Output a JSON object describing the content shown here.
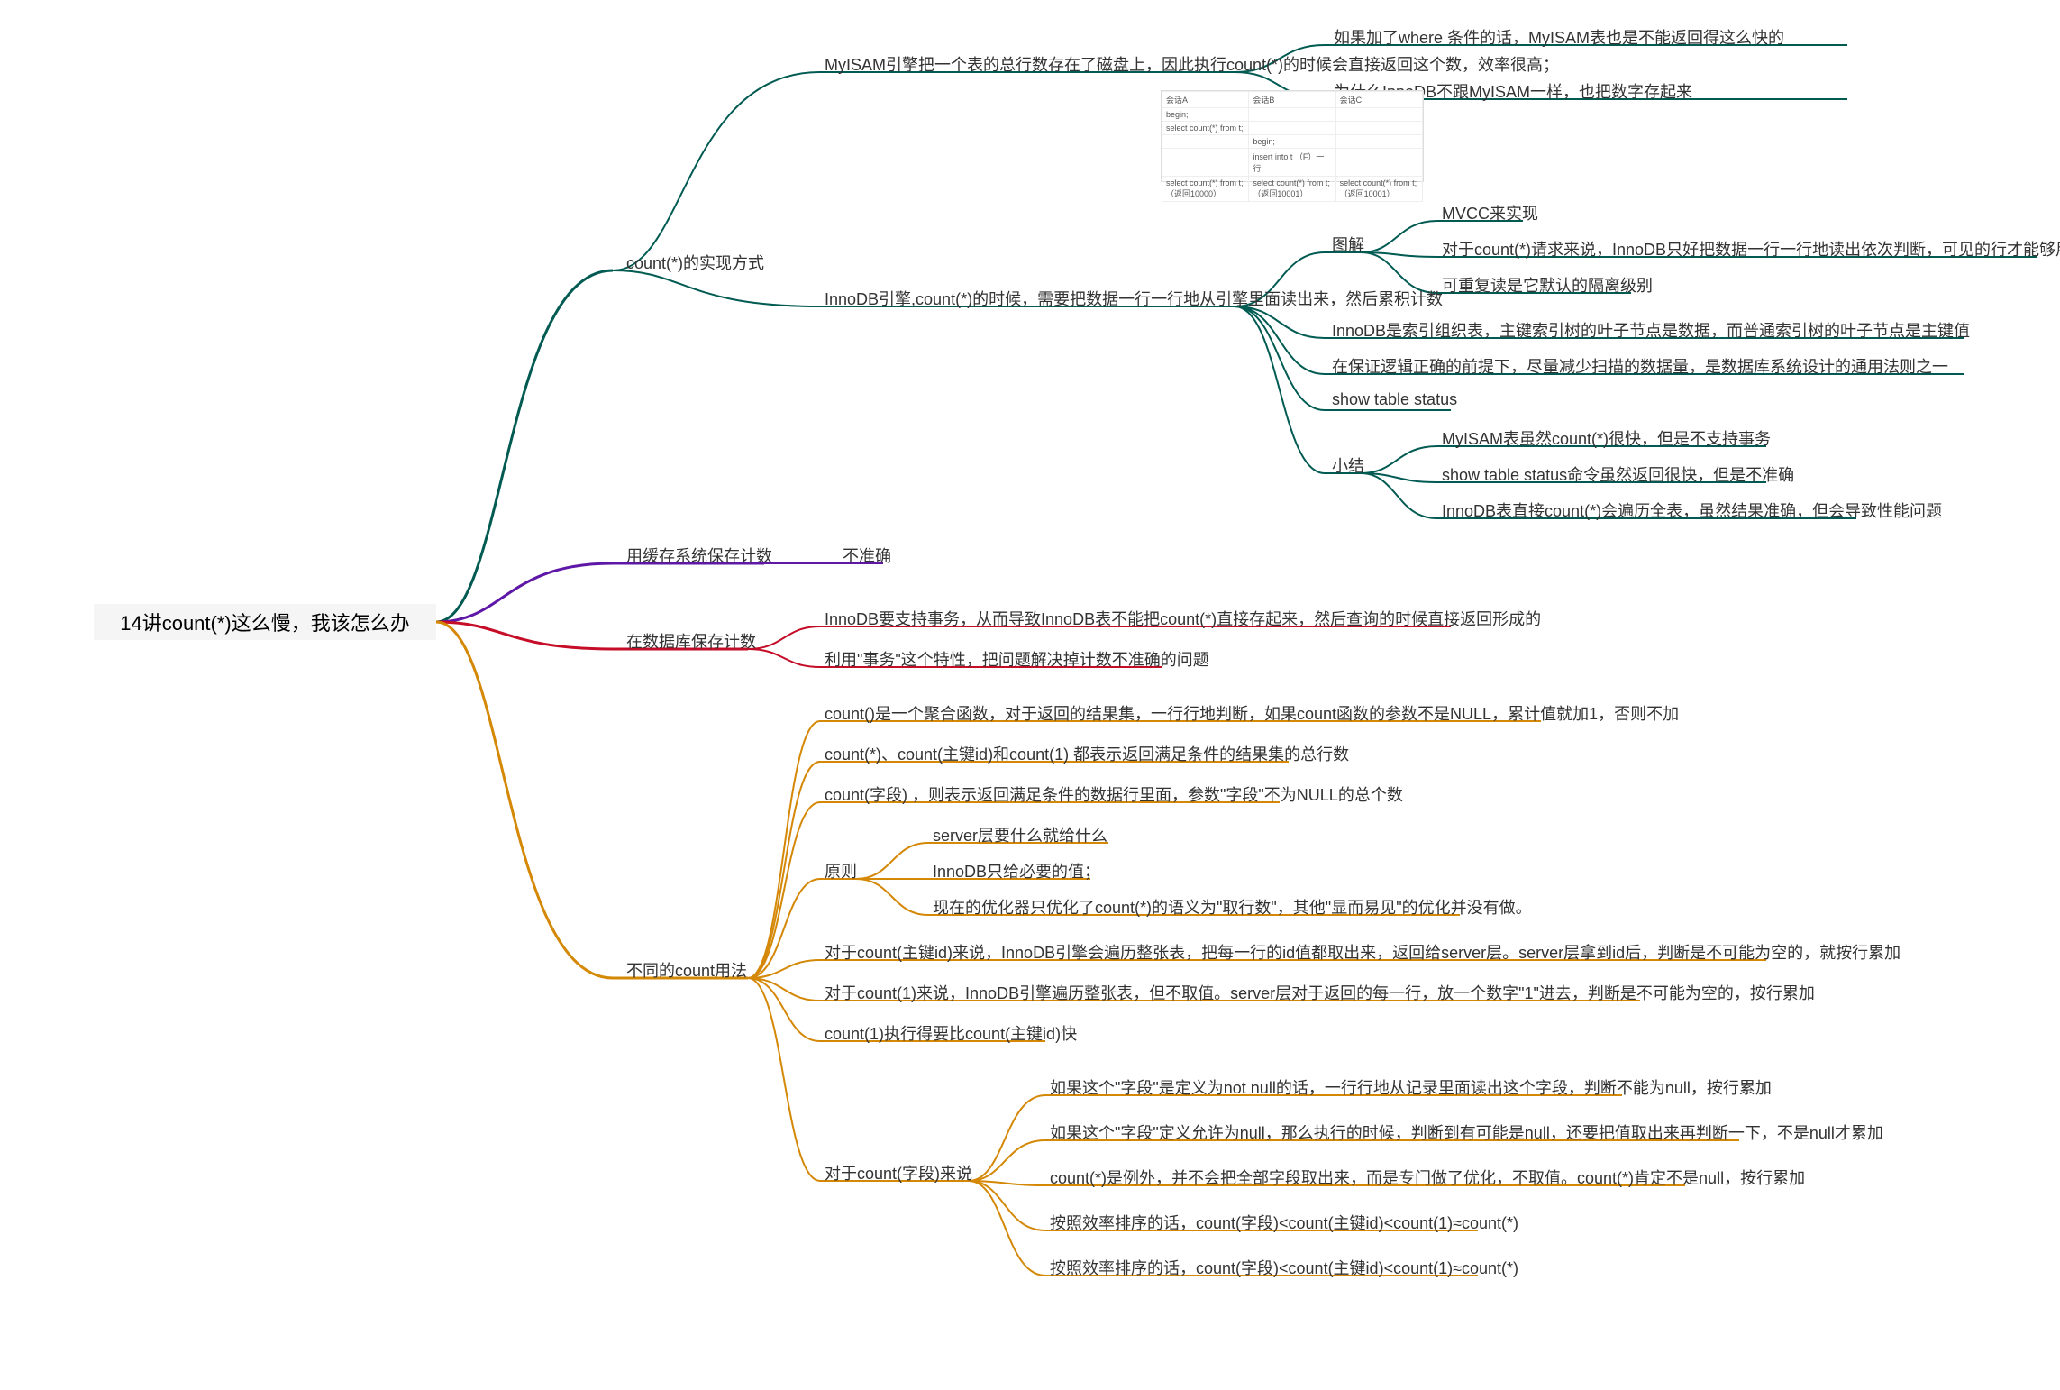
{
  "root": "14讲count(*)这么慢，我该怎么办",
  "b1": {
    "title": "count(*)的实现方式",
    "myisam": "MyISAM引擎把一个表的总行数存在了磁盘上，因此执行count(*)的时候会直接返回这个数，效率很高；",
    "myisam_c1": "如果加了where 条件的话，MyISAM表也是不能返回得这么快的",
    "myisam_c2": "为什么InnoDB不跟MyISAM一样，也把数字存起来",
    "innodb": "InnoDB引擎,count(*)的时候，需要把数据一行一行地从引擎里面读出来，然后累积计数",
    "tj": "图解",
    "tj1": "MVCC来实现",
    "tj2": "对于count(*)请求来说，InnoDB只好把数据一行一行地读出依次判断，可见的行才能够用于计算\"基于这个查询\"的表的总行数",
    "tj3": "可重复读是它默认的隔离级别",
    "tj4": "InnoDB是索引组织表，主键索引树的叶子节点是数据，而普通索引树的叶子节点是主键值",
    "tj5": "在保证逻辑正确的前提下，尽量减少扫描的数据量，是数据库系统设计的通用法则之一",
    "tj6": "show table status",
    "xj": "小结",
    "xj1": "MyISAM表虽然count(*)很快，但是不支持事务",
    "xj2": "show table status命令虽然返回很快，但是不准确",
    "xj3": "InnoDB表直接count(*)会遍历全表，虽然结果准确，但会导致性能问题"
  },
  "b2": {
    "title": "用缓存系统保存计数",
    "v": "不准确"
  },
  "b3": {
    "title": "在数据库保存计数",
    "v1": "InnoDB要支持事务，从而导致InnoDB表不能把count(*)直接存起来，然后查询的时候直接返回形成的",
    "v2": "利用\"事务\"这个特性，把问题解决掉计数不准确的问题"
  },
  "b4": {
    "title": "不同的count用法",
    "c1": "count()是一个聚合函数，对于返回的结果集，一行行地判断，如果count函数的参数不是NULL，累计值就加1，否则不加",
    "c2": "count(*)、count(主键id)和count(1) 都表示返回满足条件的结果集的总行数",
    "c3": "count(字段) ，则表示返回满足条件的数据行里面，参数\"字段\"不为NULL的总个数",
    "yz": "原则",
    "yz1": "server层要什么就给什么",
    "yz2": "InnoDB只给必要的值；",
    "yz3": "现在的优化器只优化了count(*)的语义为\"取行数\"，其他\"显而易见\"的优化并没有做。",
    "c5": "对于count(主键id)来说，InnoDB引擎会遍历整张表，把每一行的id值都取出来，返回给server层。server层拿到id后，判断是不可能为空的，就按行累加",
    "c6": "对于count(1)来说，InnoDB引擎遍历整张表，但不取值。server层对于返回的每一行，放一个数字\"1\"进去，判断是不可能为空的，按行累加",
    "c7": "count(1)执行得要比count(主键id)快",
    "zd": "对于count(字段)来说",
    "zd1": "如果这个\"字段\"是定义为not null的话，一行行地从记录里面读出这个字段，判断不能为null，按行累加",
    "zd2": "如果这个\"字段\"定义允许为null，那么执行的时候，判断到有可能是null，还要把值取出来再判断一下，不是null才累加",
    "zd3": "count(*)是例外，并不会把全部字段取出来，而是专门做了优化，不取值。count(*)肯定不是null，按行累加",
    "zd4": "按照效率排序的话，count(字段)<count(主键id)<count(1)≈count(*)",
    "zd5": "按照效率排序的话，count(字段)<count(主键id)<count(1)≈count(*)"
  },
  "thumb": {
    "h1": "会话A",
    "h2": "会话B",
    "h3": "会话C",
    "r1": "begin;",
    "r2": "select count(*) from t;",
    "r3a": "begin;",
    "r3b": "insert into t （F）一行",
    "r3c": "",
    "r4a": "select count(*) from t;（返回10000）",
    "r4b": "select count(*) from t;（返回10001）",
    "r4c": "select count(*) from t;（返回10001）"
  }
}
